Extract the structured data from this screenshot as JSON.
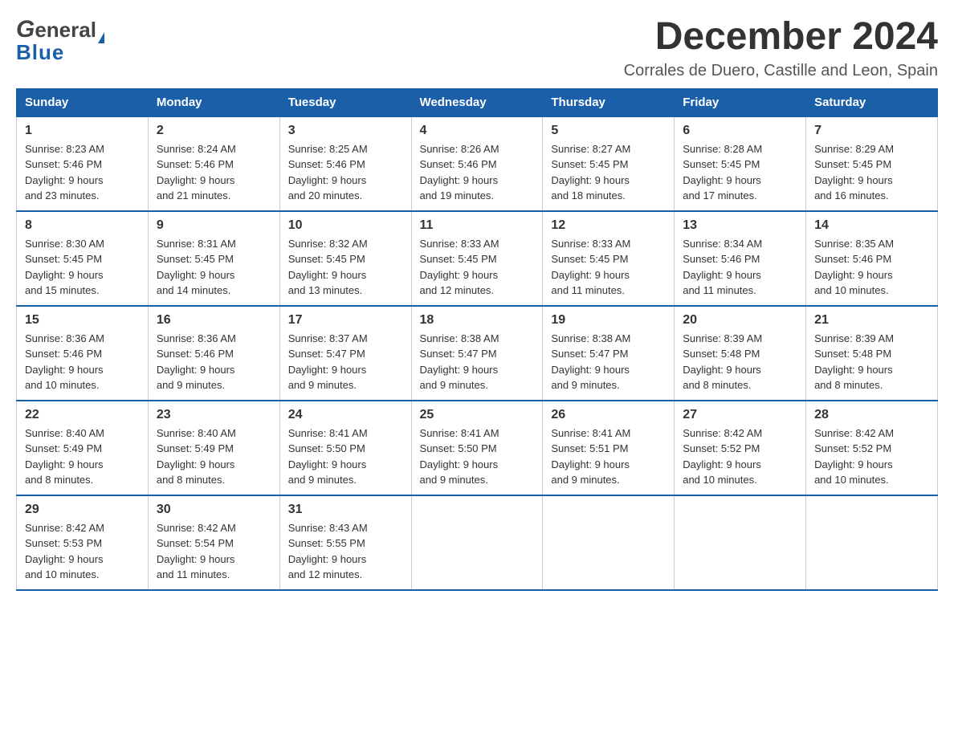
{
  "header": {
    "title": "December 2024",
    "subtitle": "Corrales de Duero, Castille and Leon, Spain",
    "logo_general": "General",
    "logo_blue": "Blue"
  },
  "days_of_week": [
    "Sunday",
    "Monday",
    "Tuesday",
    "Wednesday",
    "Thursday",
    "Friday",
    "Saturday"
  ],
  "weeks": [
    [
      {
        "day": "1",
        "sunrise": "8:23 AM",
        "sunset": "5:46 PM",
        "daylight": "9 hours and 23 minutes."
      },
      {
        "day": "2",
        "sunrise": "8:24 AM",
        "sunset": "5:46 PM",
        "daylight": "9 hours and 21 minutes."
      },
      {
        "day": "3",
        "sunrise": "8:25 AM",
        "sunset": "5:46 PM",
        "daylight": "9 hours and 20 minutes."
      },
      {
        "day": "4",
        "sunrise": "8:26 AM",
        "sunset": "5:46 PM",
        "daylight": "9 hours and 19 minutes."
      },
      {
        "day": "5",
        "sunrise": "8:27 AM",
        "sunset": "5:45 PM",
        "daylight": "9 hours and 18 minutes."
      },
      {
        "day": "6",
        "sunrise": "8:28 AM",
        "sunset": "5:45 PM",
        "daylight": "9 hours and 17 minutes."
      },
      {
        "day": "7",
        "sunrise": "8:29 AM",
        "sunset": "5:45 PM",
        "daylight": "9 hours and 16 minutes."
      }
    ],
    [
      {
        "day": "8",
        "sunrise": "8:30 AM",
        "sunset": "5:45 PM",
        "daylight": "9 hours and 15 minutes."
      },
      {
        "day": "9",
        "sunrise": "8:31 AM",
        "sunset": "5:45 PM",
        "daylight": "9 hours and 14 minutes."
      },
      {
        "day": "10",
        "sunrise": "8:32 AM",
        "sunset": "5:45 PM",
        "daylight": "9 hours and 13 minutes."
      },
      {
        "day": "11",
        "sunrise": "8:33 AM",
        "sunset": "5:45 PM",
        "daylight": "9 hours and 12 minutes."
      },
      {
        "day": "12",
        "sunrise": "8:33 AM",
        "sunset": "5:45 PM",
        "daylight": "9 hours and 11 minutes."
      },
      {
        "day": "13",
        "sunrise": "8:34 AM",
        "sunset": "5:46 PM",
        "daylight": "9 hours and 11 minutes."
      },
      {
        "day": "14",
        "sunrise": "8:35 AM",
        "sunset": "5:46 PM",
        "daylight": "9 hours and 10 minutes."
      }
    ],
    [
      {
        "day": "15",
        "sunrise": "8:36 AM",
        "sunset": "5:46 PM",
        "daylight": "9 hours and 10 minutes."
      },
      {
        "day": "16",
        "sunrise": "8:36 AM",
        "sunset": "5:46 PM",
        "daylight": "9 hours and 9 minutes."
      },
      {
        "day": "17",
        "sunrise": "8:37 AM",
        "sunset": "5:47 PM",
        "daylight": "9 hours and 9 minutes."
      },
      {
        "day": "18",
        "sunrise": "8:38 AM",
        "sunset": "5:47 PM",
        "daylight": "9 hours and 9 minutes."
      },
      {
        "day": "19",
        "sunrise": "8:38 AM",
        "sunset": "5:47 PM",
        "daylight": "9 hours and 9 minutes."
      },
      {
        "day": "20",
        "sunrise": "8:39 AM",
        "sunset": "5:48 PM",
        "daylight": "9 hours and 8 minutes."
      },
      {
        "day": "21",
        "sunrise": "8:39 AM",
        "sunset": "5:48 PM",
        "daylight": "9 hours and 8 minutes."
      }
    ],
    [
      {
        "day": "22",
        "sunrise": "8:40 AM",
        "sunset": "5:49 PM",
        "daylight": "9 hours and 8 minutes."
      },
      {
        "day": "23",
        "sunrise": "8:40 AM",
        "sunset": "5:49 PM",
        "daylight": "9 hours and 8 minutes."
      },
      {
        "day": "24",
        "sunrise": "8:41 AM",
        "sunset": "5:50 PM",
        "daylight": "9 hours and 9 minutes."
      },
      {
        "day": "25",
        "sunrise": "8:41 AM",
        "sunset": "5:50 PM",
        "daylight": "9 hours and 9 minutes."
      },
      {
        "day": "26",
        "sunrise": "8:41 AM",
        "sunset": "5:51 PM",
        "daylight": "9 hours and 9 minutes."
      },
      {
        "day": "27",
        "sunrise": "8:42 AM",
        "sunset": "5:52 PM",
        "daylight": "9 hours and 10 minutes."
      },
      {
        "day": "28",
        "sunrise": "8:42 AM",
        "sunset": "5:52 PM",
        "daylight": "9 hours and 10 minutes."
      }
    ],
    [
      {
        "day": "29",
        "sunrise": "8:42 AM",
        "sunset": "5:53 PM",
        "daylight": "9 hours and 10 minutes."
      },
      {
        "day": "30",
        "sunrise": "8:42 AM",
        "sunset": "5:54 PM",
        "daylight": "9 hours and 11 minutes."
      },
      {
        "day": "31",
        "sunrise": "8:43 AM",
        "sunset": "5:55 PM",
        "daylight": "9 hours and 12 minutes."
      },
      null,
      null,
      null,
      null
    ]
  ],
  "labels": {
    "sunrise": "Sunrise:",
    "sunset": "Sunset:",
    "daylight": "Daylight:"
  }
}
